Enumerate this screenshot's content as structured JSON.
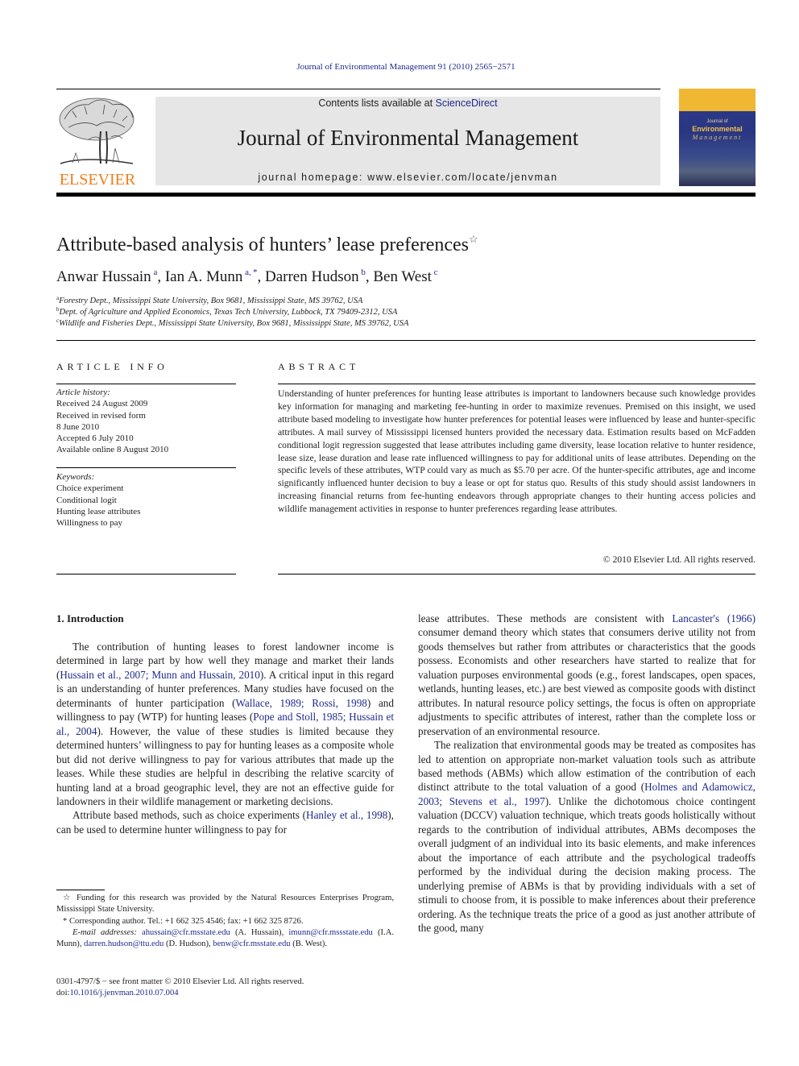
{
  "header": {
    "citation": "Journal of Environmental Management 91 (2010) 2565−2571",
    "publisher_logo_text": "ELSEVIER",
    "contents_prefix": "Contents lists available at ",
    "contents_link": "ScienceDirect",
    "journal_title": "Journal of Environmental Management",
    "homepage": "journal homepage: www.elsevier.com/locate/jenvman",
    "cover": {
      "small": "Journal of",
      "title": "Environmental",
      "subtitle": "Management"
    }
  },
  "article": {
    "title": "Attribute-based analysis of hunters’ lease preferences",
    "title_mark": "☆",
    "authors": [
      {
        "name": "Anwar Hussain",
        "sup": "a"
      },
      {
        "name": "Ian A. Munn",
        "sup": "a, *"
      },
      {
        "name": "Darren Hudson",
        "sup": "b"
      },
      {
        "name": "Ben West",
        "sup": "c"
      }
    ],
    "affiliations": [
      {
        "sup": "a",
        "text": "Forestry Dept., Mississippi State University, Box 9681, Mississippi State, MS 39762, USA"
      },
      {
        "sup": "b",
        "text": "Dept. of Agriculture and Applied Economics, Texas Tech University, Lubbock, TX 79409-2312, USA"
      },
      {
        "sup": "c",
        "text": "Wildlife and Fisheries Dept., Mississippi State University, Box 9681, Mississippi State, MS 39762, USA"
      }
    ]
  },
  "article_info": {
    "heading": "ARTICLE INFO",
    "history_label": "Article history:",
    "history": [
      "Received 24 August 2009",
      "Received in revised form",
      "8 June 2010",
      "Accepted 6 July 2010",
      "Available online 8 August 2010"
    ],
    "keywords_label": "Keywords:",
    "keywords": [
      "Choice experiment",
      "Conditional logit",
      "Hunting lease attributes",
      "Willingness to pay"
    ]
  },
  "abstract": {
    "heading": "ABSTRACT",
    "text": "Understanding of hunter preferences for hunting lease attributes is important to landowners because such knowledge provides key information for managing and marketing fee-hunting in order to maximize revenues. Premised on this insight, we used attribute based modeling to investigate how hunter preferences for potential leases were influenced by lease and hunter-specific attributes. A mail survey of Mississippi licensed hunters provided the necessary data. Estimation results based on McFadden conditional logit regression suggested that lease attributes including game diversity, lease location relative to hunter residence, lease size, lease duration and lease rate influenced willingness to pay for additional units of lease attributes. Depending on the specific levels of these attributes, WTP could vary as much as $5.70 per acre. Of the hunter-specific attributes, age and income significantly influenced hunter decision to buy a lease or opt for status quo. Results of this study should assist landowners in increasing financial returns from fee-hunting endeavors through appropriate changes to their hunting access policies and wildlife management activities in response to hunter preferences regarding lease attributes.",
    "copyright": "© 2010 Elsevier Ltd. All rights reserved."
  },
  "introduction": {
    "heading": "1.  Introduction",
    "left_p1": [
      {
        "t": "The contribution of hunting leases to forest landowner income is determined in large part by how well they manage and market their lands ("
      },
      {
        "l": "Hussain et al., 2007; Munn and Hussain, 2010"
      },
      {
        "t": "). A critical input in this regard is an understanding of hunter preferences. Many studies have focused on the determinants of hunter participation ("
      },
      {
        "l": "Wallace, 1989; Rossi, 1998"
      },
      {
        "t": ") and willingness to pay (WTP) for hunting leases ("
      },
      {
        "l": "Pope and Stoll, 1985; Hussain et al., 2004"
      },
      {
        "t": "). However, the value of these studies is limited because they determined hunters’ willingness to pay for hunting leases as a composite whole but did not derive willingness to pay for various attributes that made up the leases. While these studies are helpful in describing the relative scarcity of hunting land at a broad geographic level, they are not an effective guide for landowners in their wildlife management or marketing decisions."
      }
    ],
    "left_p2": [
      {
        "t": "Attribute based methods, such as choice experiments ("
      },
      {
        "l": "Hanley et al., 1998"
      },
      {
        "t": "), can be used to determine hunter willingness to pay for"
      }
    ],
    "right_p1": [
      {
        "t": "lease attributes. These methods are consistent with "
      },
      {
        "l": "Lancaster's (1966)"
      },
      {
        "t": " consumer demand theory which states that consumers derive utility not from goods themselves but rather from attributes or characteristics that the goods possess. Economists and other researchers have started to realize that for valuation purposes environmental goods (e.g., forest landscapes, open spaces, wetlands, hunting leases, etc.) are best viewed as composite goods with distinct attributes. In natural resource policy settings, the focus is often on appropriate adjustments to specific attributes of interest, rather than the complete loss or preservation of an environmental resource."
      }
    ],
    "right_p2": [
      {
        "t": "The realization that environmental goods may be treated as composites has led to attention on appropriate non-market valuation tools such as attribute based methods (ABMs) which allow estimation of the contribution of each distinct attribute to the total valuation of a good ("
      },
      {
        "l": "Holmes and Adamowicz, 2003; Stevens et al., 1997"
      },
      {
        "t": "). Unlike the dichotomous choice contingent valuation (DCCV) valuation technique, which treats goods holistically without regards to the contribution of individual attributes, ABMs decomposes the overall judgment of an individual into its basic elements, and make inferences about the importance of each attribute and the psychological tradeoffs performed by the individual during the decision making process. The underlying premise of ABMs is that by providing individuals with a set of stimuli to choose from, it is possible to make inferences about their preference ordering. As the technique treats the price of a good as just another attribute of the good, many"
      }
    ]
  },
  "footnotes": {
    "funding_mark": "☆",
    "funding": "Funding for this research was provided by the Natural Resources Enterprises Program, Mississippi State University.",
    "corresponding_mark": "*",
    "corresponding": "Corresponding author. Tel.: +1 662 325 4546; fax: +1 662 325 8726.",
    "email_label": "E-mail addresses:",
    "emails": [
      {
        "addr": "ahussain@cfr.msstate.edu",
        "who": "(A. Hussain),"
      },
      {
        "addr": "imunn@cfr.mssstate.edu",
        "who": "(I.A. Munn),"
      },
      {
        "addr": "darren.hudson@ttu.edu",
        "who": "(D. Hudson),"
      },
      {
        "addr": "benw@cfr.msstate.edu",
        "who": "(B. West)."
      }
    ],
    "front_matter": "0301-4797/$ − see front matter © 2010 Elsevier Ltd. All rights reserved.",
    "doi_label": "doi:",
    "doi": "10.1016/j.jenvman.2010.07.004"
  },
  "colors": {
    "link": "#1f2a8c",
    "elsevier_orange": "#f07e1e",
    "banner_bg": "#e6e6e6",
    "cover_blue": "#2e3b8a",
    "cover_yellow": "#f0b832"
  }
}
